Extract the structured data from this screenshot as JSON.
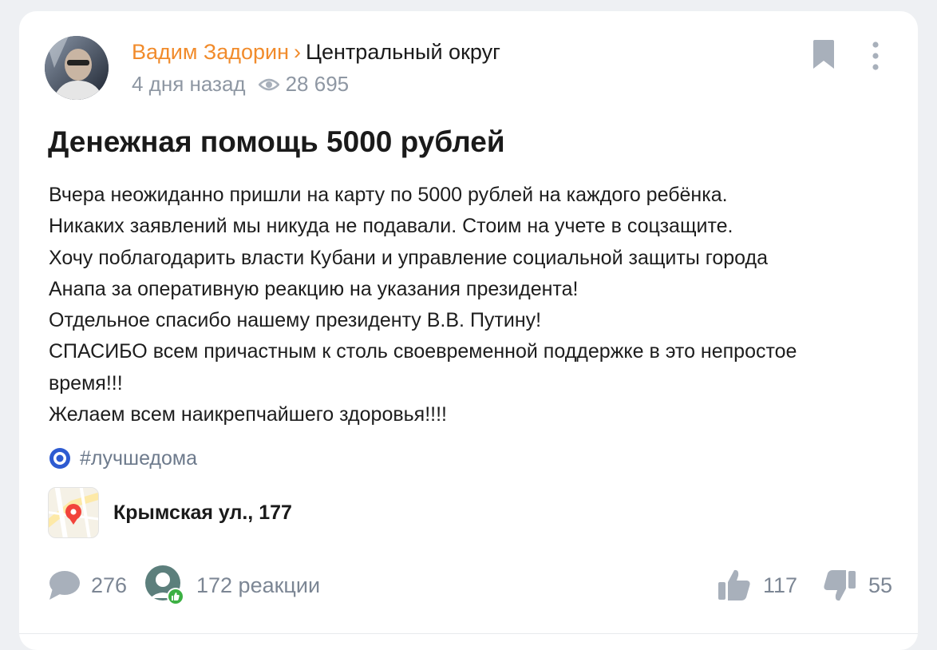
{
  "post": {
    "author": "Вадим Задорин",
    "separator": "›",
    "district": "Центральный округ",
    "time_ago": "4 дня назад",
    "views": "28 695",
    "title": "Денежная помощь 5000 рублей",
    "body_lines": [
      "Вчера неожиданно пришли на карту по 5000 рублей на каждого ребёнка.",
      "Никаких заявлений мы никуда не подавали. Стоим на учете в соцзащите.",
      "Хочу поблагодарить власти Кубани и управление социальной защиты города",
      "Анапа за оперативную реакцию на указания президента!",
      "Отдельное спасибо нашему президенту В.В. Путину!",
      "СПАСИБО всем причастным к столь своевременной поддержке в это непростое",
      "время!!!",
      "Желаем всем наикрепчайшего здоровья!!!!"
    ],
    "hashtag": "#лучшедома",
    "location": "Крымская ул., 177"
  },
  "footer": {
    "comments": "276",
    "reactions": "172 реакции",
    "likes": "117",
    "dislikes": "55"
  },
  "icons": {
    "views": "eye-icon",
    "bookmark": "bookmark-icon",
    "more": "more-vertical-icon",
    "hashtag": "hashtag-dot-icon",
    "map": "map-pin-icon",
    "comment": "comment-icon",
    "reaction": "reaction-icon",
    "like": "thumbs-up-icon",
    "dislike": "thumbs-down-icon"
  },
  "colors": {
    "author": "#f18b2b",
    "muted": "#8e97a3",
    "icon_gray": "#a8b0bb",
    "hashtag_icon": "#2e5bd1",
    "map_pin": "#f2433b",
    "reaction_badge": "#3cb043",
    "reaction_avatar": "#5c7f7c"
  }
}
